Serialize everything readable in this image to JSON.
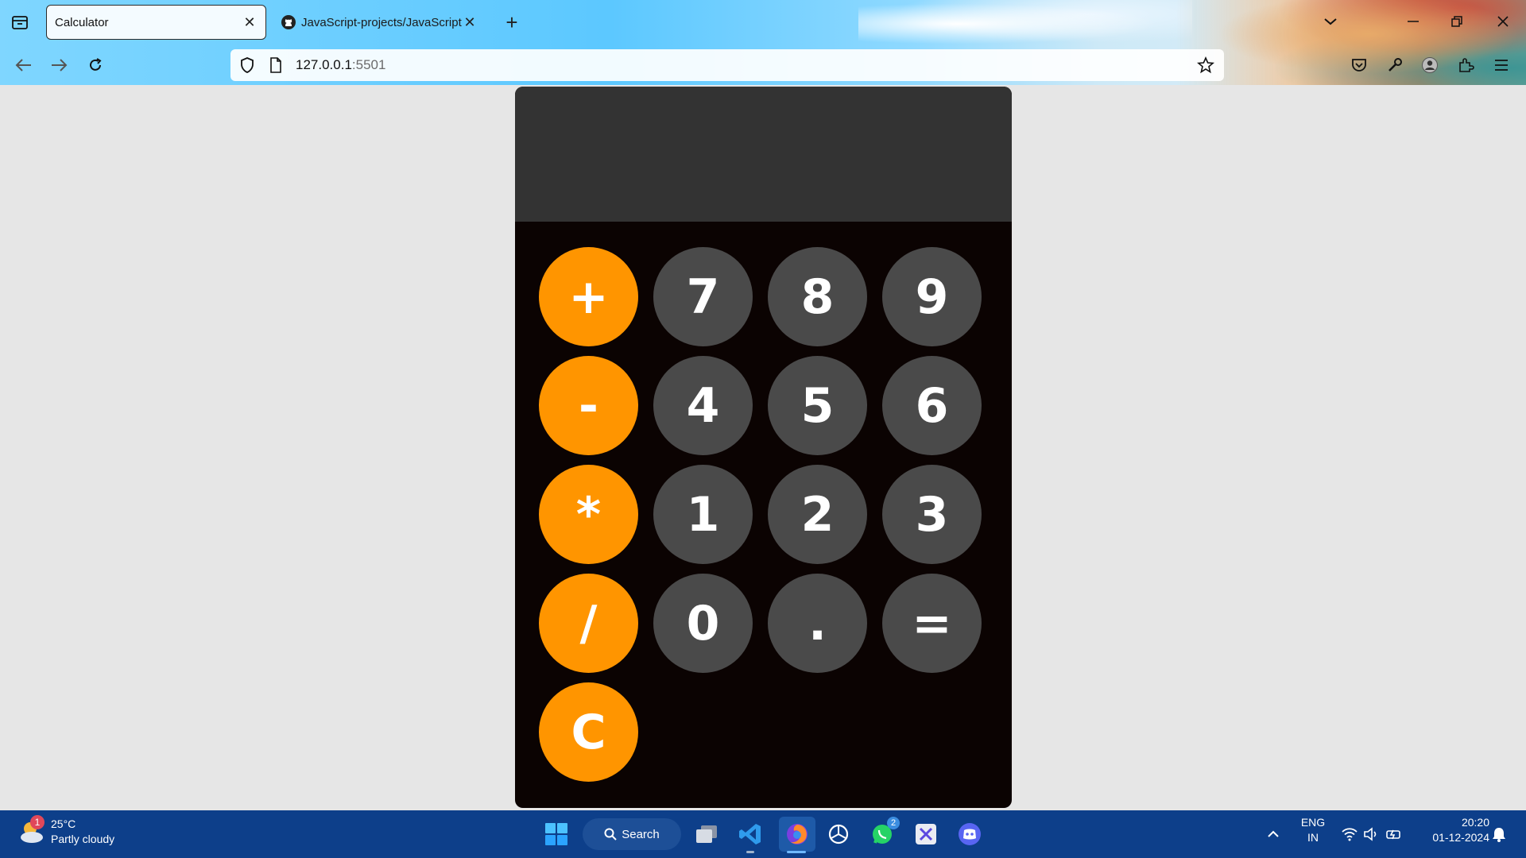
{
  "browser": {
    "tabs": [
      {
        "title": "Calculator",
        "active": true
      },
      {
        "title": "JavaScript-projects/JavaScript-P",
        "active": false
      }
    ],
    "url_host": "127.0.0.1",
    "url_port": ":5501"
  },
  "calculator": {
    "display_value": "",
    "rows": [
      [
        {
          "label": "+",
          "kind": "op"
        },
        {
          "label": "7",
          "kind": "num"
        },
        {
          "label": "8",
          "kind": "num"
        },
        {
          "label": "9",
          "kind": "num"
        }
      ],
      [
        {
          "label": "-",
          "kind": "op"
        },
        {
          "label": "4",
          "kind": "num"
        },
        {
          "label": "5",
          "kind": "num"
        },
        {
          "label": "6",
          "kind": "num"
        }
      ],
      [
        {
          "label": "*",
          "kind": "op"
        },
        {
          "label": "1",
          "kind": "num"
        },
        {
          "label": "2",
          "kind": "num"
        },
        {
          "label": "3",
          "kind": "num"
        }
      ],
      [
        {
          "label": "/",
          "kind": "op"
        },
        {
          "label": "0",
          "kind": "num"
        },
        {
          "label": ".",
          "kind": "num"
        },
        {
          "label": "=",
          "kind": "num"
        }
      ],
      [
        {
          "label": "C",
          "kind": "op"
        }
      ]
    ],
    "colors": {
      "operator": "#ff9500",
      "number": "#4a4a4a",
      "display": "#333333",
      "body": "#0b0302"
    }
  },
  "taskbar": {
    "weather_temp": "25°C",
    "weather_desc": "Partly cloudy",
    "weather_badge": "1",
    "search_label": "Search",
    "whatsapp_badge": "2",
    "lang_line1": "ENG",
    "lang_line2": "IN",
    "time": "20:20",
    "date": "01-12-2024",
    "pinned_icons": [
      "windows-start-icon",
      "task-view-icon",
      "vscode-icon",
      "firefox-icon",
      "chatgpt-icon",
      "whatsapp-icon",
      "snipping-tool-icon",
      "discord-icon"
    ]
  }
}
